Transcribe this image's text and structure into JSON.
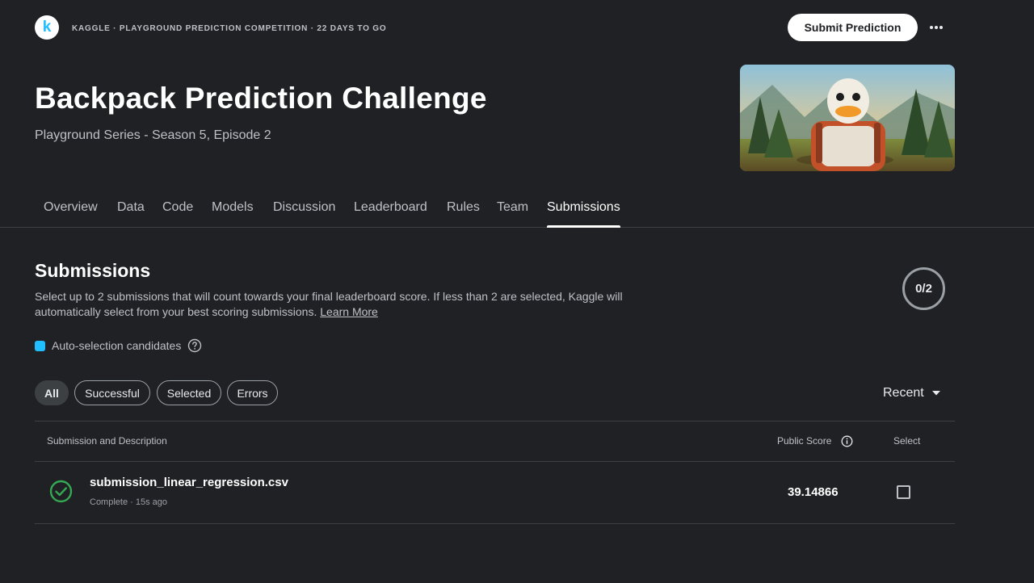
{
  "header": {
    "logo_letter": "k",
    "breadcrumb": "KAGGLE · PLAYGROUND PREDICTION COMPETITION · 22 DAYS TO GO",
    "submit_label": "Submit Prediction",
    "more_icon": "more-horizontal-icon"
  },
  "competition": {
    "title": "Backpack Prediction Challenge",
    "subtitle": "Playground Series - Season 5, Episode 2"
  },
  "tabs": [
    {
      "label": "Overview",
      "active": false
    },
    {
      "label": "Data",
      "active": false
    },
    {
      "label": "Code",
      "active": false
    },
    {
      "label": "Models",
      "active": false
    },
    {
      "label": "Discussion",
      "active": false
    },
    {
      "label": "Leaderboard",
      "active": false
    },
    {
      "label": "Rules",
      "active": false
    },
    {
      "label": "Team",
      "active": false
    },
    {
      "label": "Submissions",
      "active": true
    }
  ],
  "submissions": {
    "title": "Submissions",
    "description": "Select up to 2 submissions that will count towards your final leaderboard score. If less than 2 are selected, Kaggle will automatically select from your best scoring submissions.",
    "learn_more": "Learn More",
    "counter": "0/2",
    "auto_selection_label": "Auto-selection candidates",
    "auto_selection_color": "#20beff",
    "filters": [
      {
        "label": "All",
        "active": true
      },
      {
        "label": "Successful",
        "active": false
      },
      {
        "label": "Selected",
        "active": false
      },
      {
        "label": "Errors",
        "active": false
      }
    ],
    "sort_label": "Recent"
  },
  "table": {
    "columns": {
      "submission": "Submission and Description",
      "score": "Public Score",
      "select": "Select"
    },
    "rows": [
      {
        "filename": "submission_linear_regression.csv",
        "status": "Complete · 15s ago",
        "score": "39.14866",
        "status_icon": "check-circle-icon",
        "status_color": "#34a853",
        "selected": false
      }
    ]
  }
}
